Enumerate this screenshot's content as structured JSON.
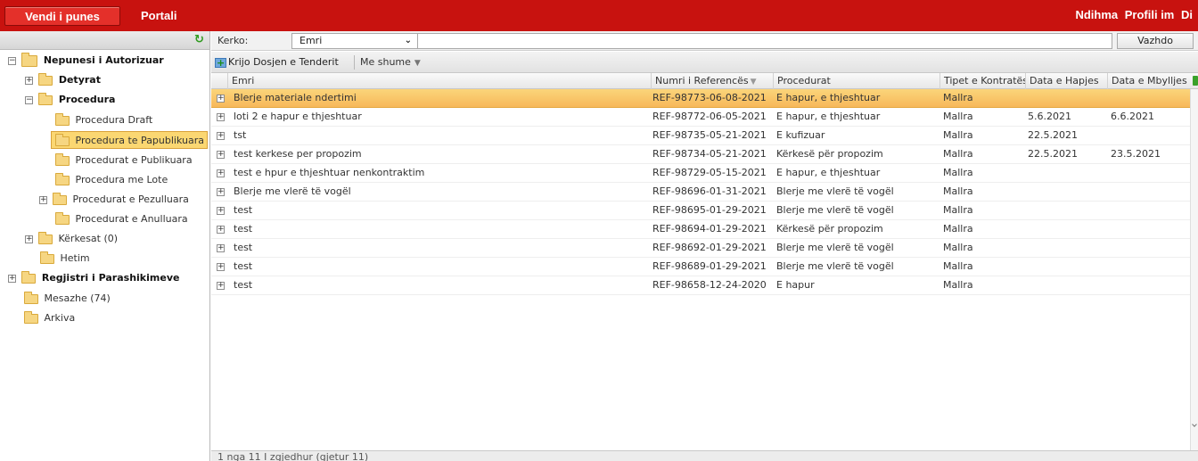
{
  "topbar": {
    "tab_active": "Vendi i punes",
    "tab_portal": "Portali",
    "right_links": [
      "Ndihma",
      "Profili im",
      "Di"
    ]
  },
  "sidebar": {
    "root": "Nepunesi i Autorizuar",
    "items": [
      {
        "label": "Detyrat"
      },
      {
        "label": "Procedura"
      },
      {
        "label": "Procedura Draft"
      },
      {
        "label": "Procedura te Papublikuara"
      },
      {
        "label": "Procedurat e Publikuara"
      },
      {
        "label": "Procedura me Lote"
      },
      {
        "label": "Procedurat e Pezulluara"
      },
      {
        "label": "Procedurat e Anulluara"
      },
      {
        "label": "Kërkesat (0)"
      },
      {
        "label": "Hetim"
      },
      {
        "label": "Regjistri i Parashikimeve"
      },
      {
        "label": "Mesazhe (74)"
      },
      {
        "label": "Arkiva"
      }
    ]
  },
  "search": {
    "label": "Kerko:",
    "field_selected": "Emri",
    "input_value": "",
    "button": "Vazhdo"
  },
  "toolbar": {
    "create_label": "Krijo Dosjen e Tenderit",
    "more_label": "Me shume"
  },
  "grid": {
    "columns": [
      "Emri",
      "Numri i Referencës",
      "Procedurat",
      "Tipet e Kontratës",
      "Data e Hapjes",
      "Data e Mbylljes"
    ],
    "rows": [
      [
        "Blerje materiale ndertimi",
        "REF-98773-06-08-2021",
        "E hapur, e thjeshtuar",
        "Mallra",
        "",
        ""
      ],
      [
        "loti 2 e hapur e thjeshtuar",
        "REF-98772-06-05-2021",
        "E hapur, e thjeshtuar",
        "Mallra",
        "5.6.2021",
        "6.6.2021"
      ],
      [
        "tst",
        "REF-98735-05-21-2021",
        "E kufizuar",
        "Mallra",
        "22.5.2021",
        ""
      ],
      [
        "test kerkese per propozim",
        "REF-98734-05-21-2021",
        "Kërkesë për propozim",
        "Mallra",
        "22.5.2021",
        "23.5.2021"
      ],
      [
        "test e hpur e thjeshtuar nenkontraktim",
        "REF-98729-05-15-2021",
        "E hapur, e thjeshtuar",
        "Mallra",
        "",
        ""
      ],
      [
        "Blerje me vlerë të vogël",
        "REF-98696-01-31-2021",
        "Blerje me vlerë të vogël",
        "Mallra",
        "",
        ""
      ],
      [
        "test",
        "REF-98695-01-29-2021",
        "Blerje me vlerë të vogël",
        "Mallra",
        "",
        ""
      ],
      [
        "test",
        "REF-98694-01-29-2021",
        "Kërkesë për propozim",
        "Mallra",
        "",
        ""
      ],
      [
        "test",
        "REF-98692-01-29-2021",
        "Blerje me vlerë të vogël",
        "Mallra",
        "",
        ""
      ],
      [
        "test",
        "REF-98689-01-29-2021",
        "Blerje me vlerë të vogël",
        "Mallra",
        "",
        ""
      ],
      [
        "test",
        "REF-98658-12-24-2020",
        "E hapur",
        "Mallra",
        "",
        ""
      ]
    ],
    "footer": "1 nga 11 I zgjedhur (gjetur 11)"
  },
  "colors": {
    "topbar": "#c8120f",
    "selected_row": "#f7b85a",
    "selected_tree": "#fbd772"
  }
}
